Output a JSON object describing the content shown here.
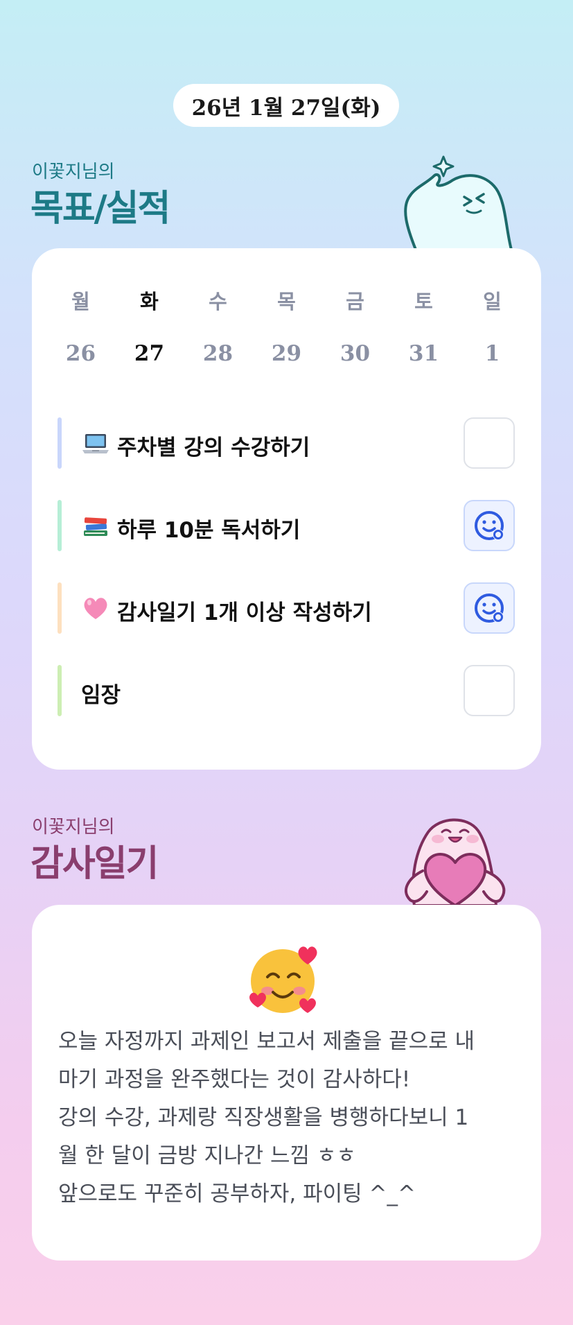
{
  "date": "26년 1월 27일(화)",
  "goals_section": {
    "owner": "이꽃지님의",
    "title": "목표/실적"
  },
  "calendar": {
    "days": [
      {
        "name": "월",
        "date": "26",
        "selected": false
      },
      {
        "name": "화",
        "date": "27",
        "selected": true
      },
      {
        "name": "수",
        "date": "28",
        "selected": false
      },
      {
        "name": "목",
        "date": "29",
        "selected": false
      },
      {
        "name": "금",
        "date": "30",
        "selected": false
      },
      {
        "name": "토",
        "date": "31",
        "selected": false
      },
      {
        "name": "일",
        "date": "1",
        "selected": false
      }
    ]
  },
  "tasks": [
    {
      "icon": "laptop-icon",
      "label": "주차별 강의 수강하기",
      "bar_color": "#c9d6fb",
      "done": false
    },
    {
      "icon": "books-icon",
      "label": "하루 10분 독서하기",
      "bar_color": "#b6eed6",
      "done": true
    },
    {
      "icon": "pink-heart-icon",
      "label": "감사일기 1개 이상 작성하기",
      "bar_color": "#fde0bf",
      "done": true
    },
    {
      "icon": "",
      "label": "임장",
      "bar_color": "#cdeeb3",
      "done": false
    }
  ],
  "diary_section": {
    "owner": "이꽃지님의",
    "title": "감사일기"
  },
  "diary": {
    "emoji": "smiling-face-with-hearts-icon",
    "lines": [
      "오늘 자정까지 과제인 보고서 제출을 끝으로 내",
      "마기 과정을 완주했다는 것이 감사하다!",
      "강의 수강, 과제랑 직장생활을 병행하다보니 1",
      "월 한 달이 금방 지나간 느낌 ㅎㅎ",
      "앞으로도 꾸준히 공부하자, 파이팅 ^_^"
    ]
  },
  "colors": {
    "goals_title": "#1d7a86",
    "diary_title": "#8a3e6e",
    "check_done_bg": "#edf2ff",
    "check_done_icon": "#2f5be0"
  }
}
